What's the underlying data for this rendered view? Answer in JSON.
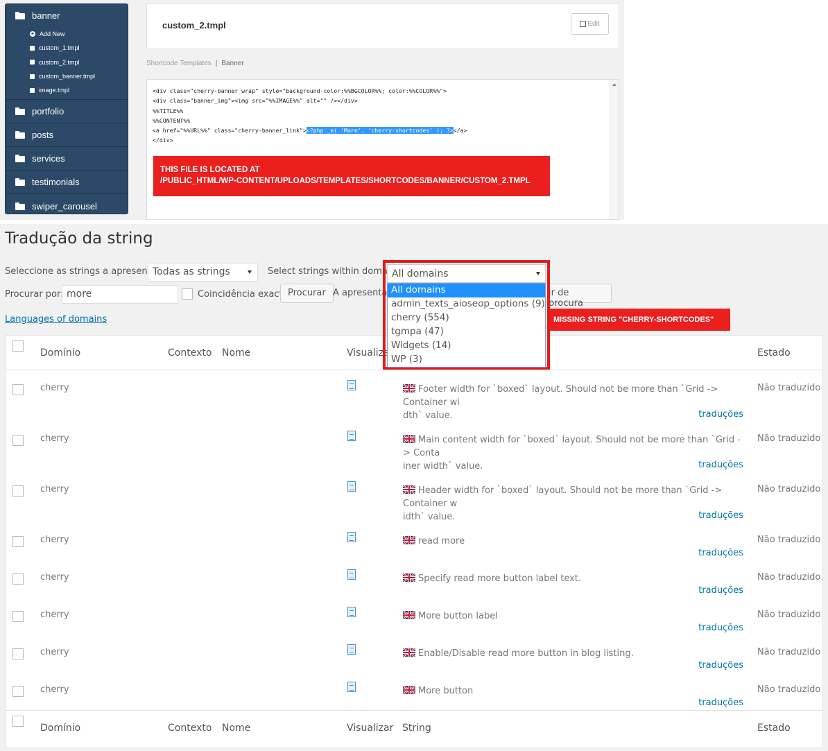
{
  "sidebar": {
    "folders": [
      {
        "label": "banner",
        "open": true
      },
      {
        "label": "portfolio"
      },
      {
        "label": "posts"
      },
      {
        "label": "services"
      },
      {
        "label": "testimonials"
      },
      {
        "label": "swiper_carousel"
      }
    ],
    "banner_items": [
      "Add New",
      "custom_1.tmpl",
      "custom_2.tmpl",
      "custom_banner.tmpl",
      "image.tmpl"
    ]
  },
  "editor": {
    "file_title": "custom_2.tmpl",
    "edit_label": "Edit",
    "breadcrumb_root": "Shortcode Templates",
    "breadcrumb_sep": "|",
    "breadcrumb_current": "Banner",
    "code_lines": [
      "<div class=\"cherry-banner_wrap\" style=\"background-color:%%BGCOLOR%%; color:%%COLOR%%\">",
      "<div class=\"banner_img\"><img src=\"%%IMAGE%%\" alt=\"\" /></div>",
      "%%TITLE%%",
      "%%CONTENT%%",
      "<a href=\"%%URL%%\" class=\"cherry-banner_link\">",
      "</div>"
    ],
    "code_selected": "<?php _e( 'More', 'cherry-shortcodes' ); ?>",
    "code_tail": "</a>",
    "file_note_line1": "THIS FILE IS LOCATED AT",
    "file_note_line2": "/PUBLIC_HTML/WP-CONTENT/UPLOADS/TEMPLATES/SHORTCODES/BANNER/CUSTOM_2.TMPL"
  },
  "strings_page": {
    "title": "Tradução da string",
    "select_label": "Seleccione as strings a apresentar:",
    "select_value": "Todas as strings",
    "domain_label": "Select strings within domain:",
    "domain_value": "All domains",
    "domain_options": [
      "All domains",
      "admin_texts_aioseop_options (9)",
      "cherry (554)",
      "tgmpa (47)",
      "Widgets (14)",
      "WP (3)"
    ],
    "search_label": "Procurar por:",
    "search_value": "more",
    "exact_label": "Coincidência exacta",
    "search_button": "Procurar",
    "showing_text": "A apresenta",
    "clear_button_partial": "ir de procura",
    "languages_link": "Languages of domains",
    "missing_note": "MISSING STRING \"CHERRY-SHORTCODES\"",
    "columns": {
      "domain": "Domínio",
      "context": "Contexto",
      "name": "Nome",
      "view_partial": "Visualiza",
      "view": "Visualizar",
      "string": "String",
      "status": "Estado"
    },
    "translations_link": "traduções",
    "rows": [
      {
        "domain": "cherry",
        "string": "Footer width for `boxed` layout. Should not be more than `Grid -> Container wi",
        "string2": "dth` value.",
        "status": "Não traduzido"
      },
      {
        "domain": "cherry",
        "string": "Main content width for `boxed` layout. Should not be more than `Grid -> Conta",
        "string2": "iner width` value.",
        "status": "Não traduzido"
      },
      {
        "domain": "cherry",
        "string": "Header width for `boxed` layout. Should not be more than `Grid -> Container w",
        "string2": "idth` value.",
        "status": "Não traduzido"
      },
      {
        "domain": "cherry",
        "string": "read more",
        "string2": "",
        "status": "Não traduzido"
      },
      {
        "domain": "cherry",
        "string": "Specify read more button label text.",
        "string2": "",
        "status": "Não traduzido"
      },
      {
        "domain": "cherry",
        "string": "More button label",
        "string2": "",
        "status": "Não traduzido"
      },
      {
        "domain": "cherry",
        "string": "Enable/Disable read more button in blog listing.",
        "string2": "",
        "status": "Não traduzido"
      },
      {
        "domain": "cherry",
        "string": "More button",
        "string2": "",
        "status": "Não traduzido"
      }
    ]
  },
  "colors": {
    "sidebar_bg": "#2c4a68",
    "highlight_red": "#ec1f1f",
    "link_blue": "#0073aa",
    "select_blue": "#1e90ff"
  }
}
